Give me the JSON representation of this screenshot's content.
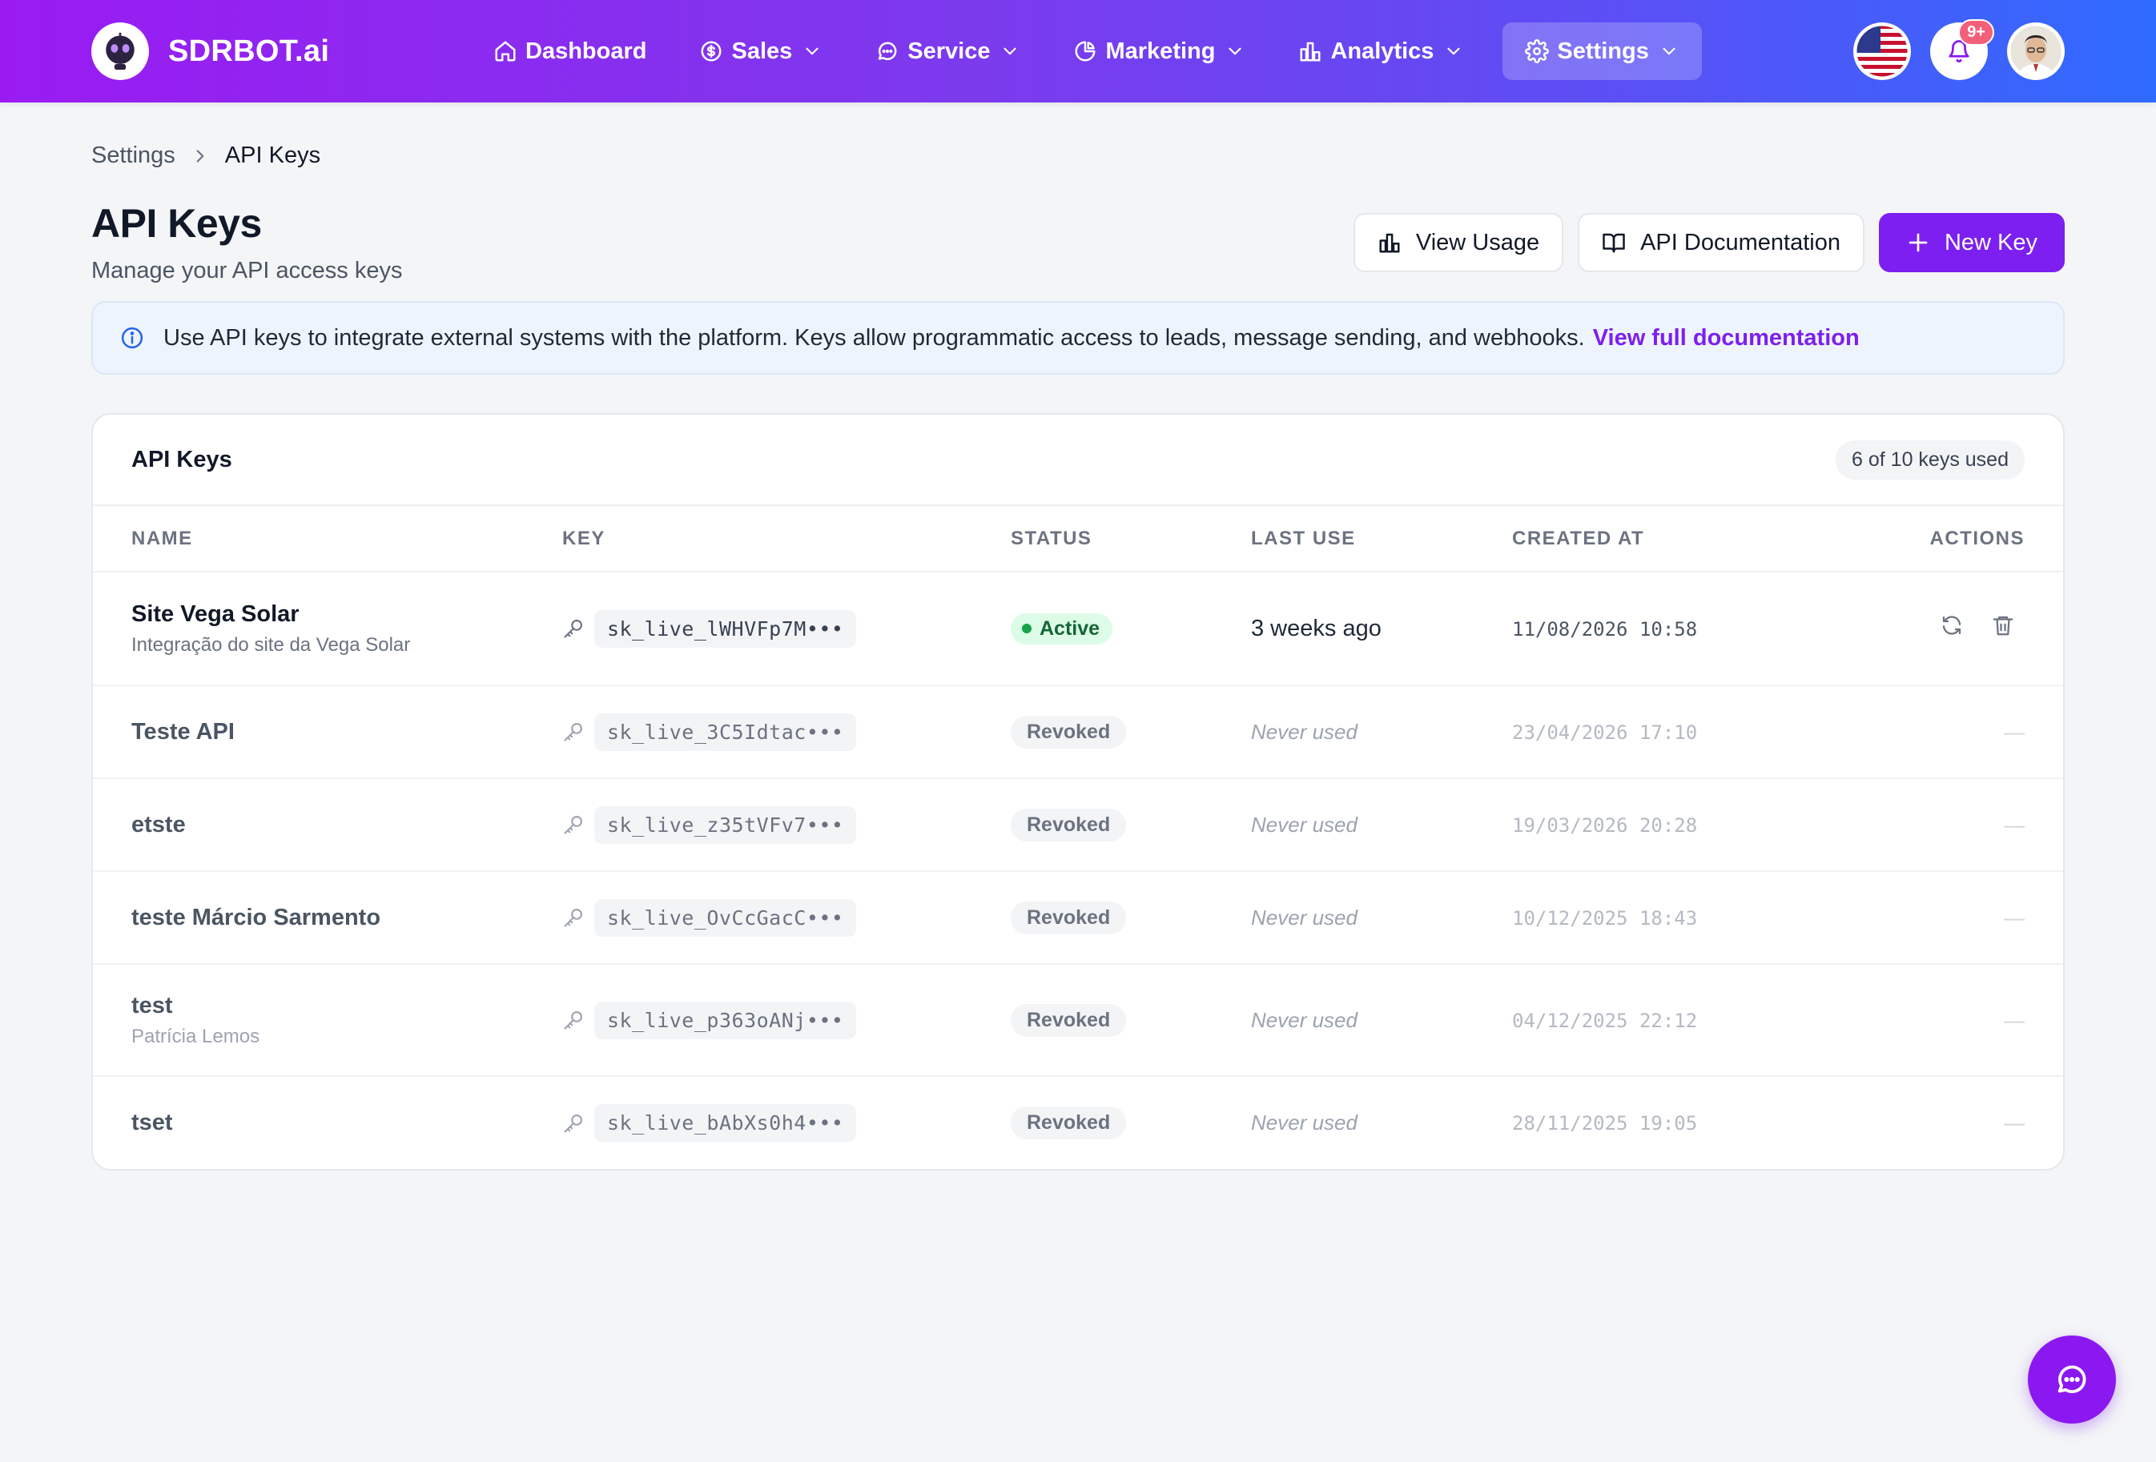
{
  "brand": {
    "name": "SDRBOT.ai"
  },
  "nav": {
    "items": [
      {
        "label": "Dashboard",
        "icon": "home-icon",
        "has_dropdown": false
      },
      {
        "label": "Sales",
        "icon": "dollar-icon",
        "has_dropdown": true
      },
      {
        "label": "Service",
        "icon": "chat-icon",
        "has_dropdown": true
      },
      {
        "label": "Marketing",
        "icon": "pie-chart-icon",
        "has_dropdown": true
      },
      {
        "label": "Analytics",
        "icon": "bar-chart-icon",
        "has_dropdown": true
      },
      {
        "label": "Settings",
        "icon": "gear-icon",
        "has_dropdown": true,
        "active": true
      }
    ],
    "notifications_badge": "9+",
    "language_flag": "us-flag-icon"
  },
  "breadcrumb": {
    "parent": "Settings",
    "current": "API Keys"
  },
  "header": {
    "title": "API Keys",
    "subtitle": "Manage your API access keys",
    "view_usage": "View Usage",
    "api_docs": "API Documentation",
    "new_key": "New Key"
  },
  "info": {
    "text": "Use API keys to integrate external systems with the platform. Keys allow programmatic access to leads, message sending, and webhooks.",
    "link": "View full documentation"
  },
  "card": {
    "title": "API Keys",
    "usage": "6 of 10 keys used",
    "columns": {
      "name": "NAME",
      "key": "KEY",
      "status": "STATUS",
      "last_use": "LAST USE",
      "created_at": "CREATED AT",
      "actions": "ACTIONS"
    },
    "rows": [
      {
        "name": "Site Vega Solar",
        "description": "Integração do site da Vega Solar",
        "key": "sk_live_lWHVFp7M•••",
        "status": "Active",
        "last_use": "3 weeks ago",
        "created_at": "11/08/2026 10:58",
        "actions": ""
      },
      {
        "name": "Teste API",
        "description": "",
        "key": "sk_live_3C5Idtac•••",
        "status": "Revoked",
        "last_use": "Never used",
        "created_at": "23/04/2026 17:10",
        "actions": "—"
      },
      {
        "name": "etste",
        "description": "",
        "key": "sk_live_z35tVFv7•••",
        "status": "Revoked",
        "last_use": "Never used",
        "created_at": "19/03/2026 20:28",
        "actions": "—"
      },
      {
        "name": "teste Márcio Sarmento",
        "description": "",
        "key": "sk_live_OvCcGacC•••",
        "status": "Revoked",
        "last_use": "Never used",
        "created_at": "10/12/2025 18:43",
        "actions": "—"
      },
      {
        "name": "test",
        "description": "Patrícia Lemos",
        "key": "sk_live_p363oANj•••",
        "status": "Revoked",
        "last_use": "Never used",
        "created_at": "04/12/2025 22:12",
        "actions": "—"
      },
      {
        "name": "tset",
        "description": "",
        "key": "sk_live_bAbXs0h4•••",
        "status": "Revoked",
        "last_use": "Never used",
        "created_at": "28/11/2025 19:05",
        "actions": "—"
      }
    ]
  },
  "colors": {
    "primary": "#7c1ff0",
    "active_status": "#16a34a",
    "info_bg": "#eef4fd"
  }
}
